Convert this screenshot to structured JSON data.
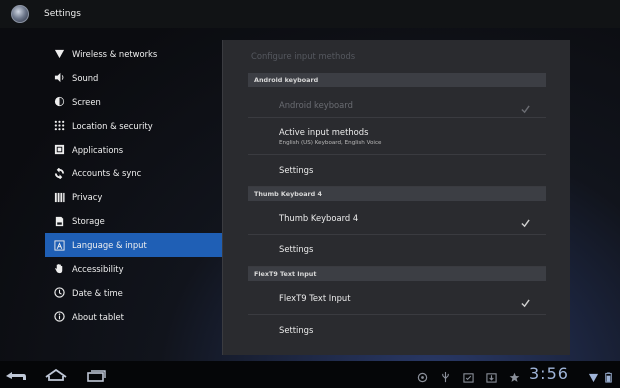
{
  "app": {
    "title": "Settings",
    "icon": "settings-app-icon"
  },
  "sidebar": {
    "items": [
      {
        "label": "Wireless & networks",
        "icon": "wifi-icon"
      },
      {
        "label": "Sound",
        "icon": "speaker-icon"
      },
      {
        "label": "Screen",
        "icon": "brightness-icon"
      },
      {
        "label": "Location & security",
        "icon": "grid-lock-icon"
      },
      {
        "label": "Applications",
        "icon": "applications-icon"
      },
      {
        "label": "Accounts & sync",
        "icon": "sync-icon"
      },
      {
        "label": "Privacy",
        "icon": "privacy-icon"
      },
      {
        "label": "Storage",
        "icon": "storage-icon"
      },
      {
        "label": "Language & input",
        "icon": "language-icon",
        "active": true
      },
      {
        "label": "Accessibility",
        "icon": "hand-icon"
      },
      {
        "label": "Date & time",
        "icon": "clock-icon"
      },
      {
        "label": "About tablet",
        "icon": "info-icon"
      }
    ]
  },
  "main": {
    "title": "Configure input methods",
    "sections": [
      {
        "header": "Android keyboard",
        "rows": [
          {
            "title": "Android keyboard",
            "checked": true,
            "disabled": true
          },
          {
            "title": "Active input methods",
            "summary": "English (US) Keyboard, English Voice"
          },
          {
            "title": "Settings"
          }
        ]
      },
      {
        "header": "Thumb Keyboard 4",
        "rows": [
          {
            "title": "Thumb Keyboard 4",
            "checked": true
          },
          {
            "title": "Settings"
          }
        ]
      },
      {
        "header": "FlexT9 Text Input",
        "rows": [
          {
            "title": "FlexT9 Text Input",
            "checked": true
          },
          {
            "title": "Settings"
          }
        ]
      }
    ]
  },
  "system_bar": {
    "clock": "3:56",
    "nav": [
      "back-icon",
      "home-icon",
      "recent-apps-icon"
    ],
    "tray": [
      "android-icon",
      "usb-icon",
      "calendar-icon",
      "download-icon",
      "star-icon",
      "wifi-signal-icon",
      "battery-icon"
    ],
    "accent": "#9fb4d8"
  },
  "colors": {
    "selected": "#1f5fb5",
    "panel": "#2a2b2f"
  }
}
